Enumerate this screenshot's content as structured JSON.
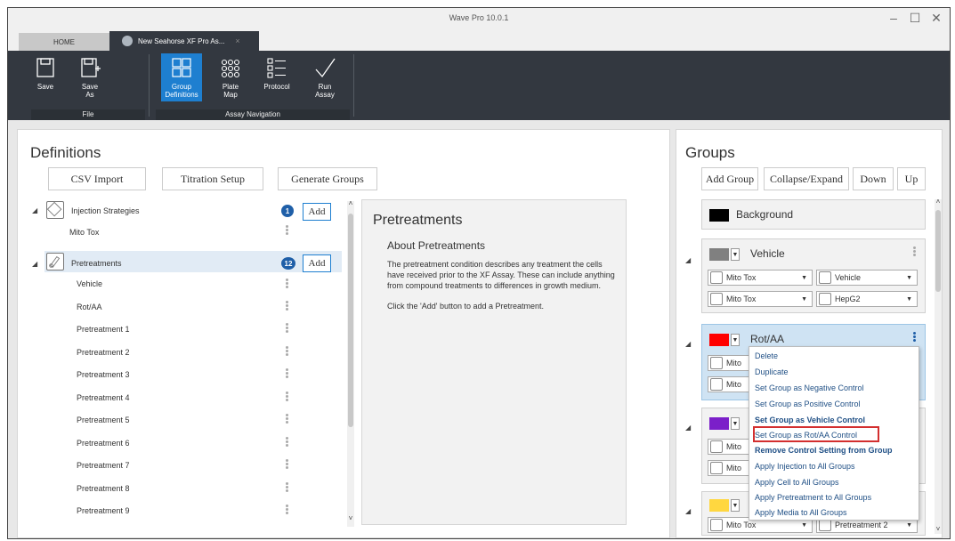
{
  "window": {
    "title": "Wave Pro 10.0.1",
    "controls": [
      "–",
      "☐",
      "✕"
    ]
  },
  "tabs": {
    "home": "HOME",
    "document": "New Seahorse XF Pro As..."
  },
  "ribbon": {
    "save": "Save",
    "save_as_1": "Save",
    "save_as_2": "As",
    "group_defs_1": "Group",
    "group_defs_2": "Definitions",
    "plate_map_1": "Plate",
    "plate_map_2": "Map",
    "protocol": "Protocol",
    "run_assay_1": "Run",
    "run_assay_2": "Assay",
    "file_caption": "File",
    "nav_caption": "Assay Navigation"
  },
  "definitions": {
    "title": "Definitions",
    "csv_import": "CSV Import",
    "titration_setup": "Titration Setup",
    "generate_groups": "Generate Groups",
    "injection": {
      "label": "Injection Strategies",
      "badge": "1",
      "add": "Add",
      "items": [
        "Mito Tox"
      ]
    },
    "pretreatments": {
      "label": "Pretreatments",
      "badge": "12",
      "add": "Add",
      "items": [
        "Vehicle",
        "Rot/AA",
        "Pretreatment 1",
        "Pretreatment 2",
        "Pretreatment 3",
        "Pretreatment 4",
        "Pretreatment 5",
        "Pretreatment 6",
        "Pretreatment 7",
        "Pretreatment 8",
        "Pretreatment 9"
      ]
    },
    "info": {
      "title": "Pretreatments",
      "subtitle": "About Pretreatments",
      "body": "The pretreatment condition describes any treatment the cells have received prior to the XF Assay.  These can include anything from compound treatments to differences in growth medium.",
      "click": "Click the 'Add' button to add a Pretreatment."
    }
  },
  "groups": {
    "title": "Groups",
    "add_group": "Add Group",
    "collapse": "Collapse/Expand",
    "down": "Down",
    "up": "Up",
    "background": {
      "name": "Background",
      "color": "#000000"
    },
    "vehicle": {
      "name": "Vehicle",
      "color": "#808080",
      "injection": "Mito Tox",
      "pretreatment": "Vehicle",
      "assay_media": "Mito Tox",
      "cell": "HepG2"
    },
    "rotaa": {
      "name": "Rot/AA",
      "color": "#ff0000",
      "injection": "Mito",
      "assay_media": "Mito"
    },
    "group4": {
      "color": "#7b1fc9",
      "injection": "Mito",
      "assay_media": "Mito"
    },
    "group5": {
      "color": "#ffd740",
      "injection": "Mito Tox",
      "pretreatment": "Pretreatment 2"
    }
  },
  "context_menu": {
    "items": [
      "Delete",
      "Duplicate",
      "Set Group as Negative Control",
      "Set Group as Positive Control",
      "Set Group as Vehicle Control",
      "Set Group as Rot/AA Control",
      "Remove Control Setting from Group",
      "Apply Injection to All Groups",
      "Apply Cell to All Groups",
      "Apply Pretreatment to All Groups",
      "Apply Media to All Groups"
    ]
  }
}
